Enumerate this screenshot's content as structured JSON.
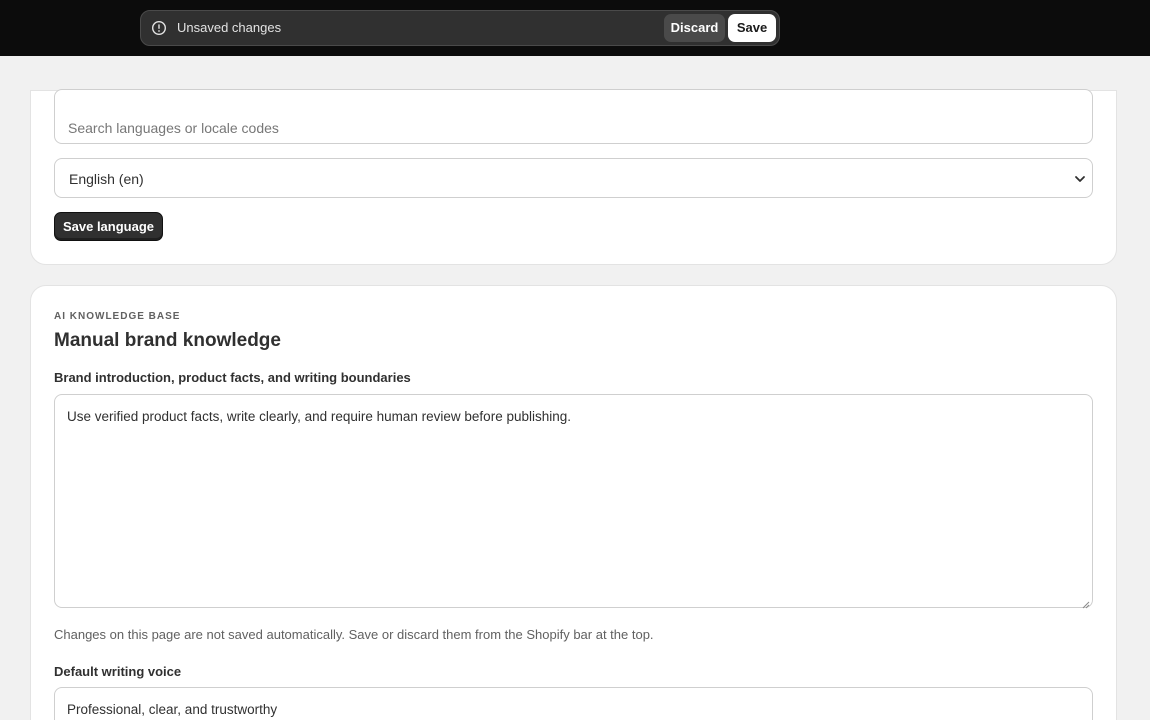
{
  "save_bar": {
    "message": "Unsaved changes",
    "discard_label": "Discard",
    "save_label": "Save",
    "icon": "alert-circle-icon"
  },
  "language_section": {
    "search_placeholder": "Search languages or locale codes",
    "selected_language": "English (en)",
    "save_button_label": "Save language"
  },
  "knowledge_section": {
    "overline": "AI KNOWLEDGE BASE",
    "title": "Manual brand knowledge",
    "brand_label": "Brand introduction, product facts, and writing boundaries",
    "brand_value": "Use verified product facts, write clearly, and require human review before publishing.",
    "help_text": "Changes on this page are not saved automatically. Save or discard them from the Shopify bar at the top.",
    "voice_label": "Default writing voice",
    "voice_value": "Professional, clear, and trustworthy"
  },
  "colors": {
    "topbar_bg": "#0c0c0c",
    "savebar_bg": "#303030",
    "primary_button": "#303030"
  }
}
